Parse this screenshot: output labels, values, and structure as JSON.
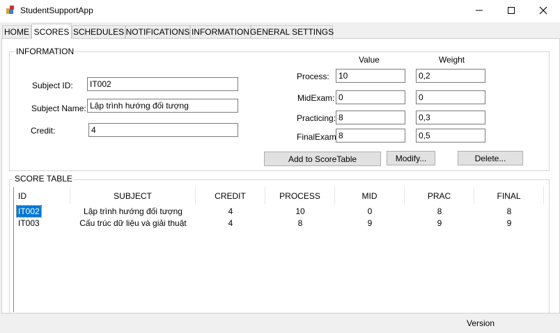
{
  "window": {
    "title": "StudentSupportApp",
    "icons": {
      "app": "app-icon",
      "minimize": "minimize-icon",
      "maximize": "maximize-icon",
      "close": "close-icon"
    }
  },
  "tabs": [
    "HOME",
    "SCORES",
    "SCHEDULES",
    "NOTIFICATIONS",
    "INFORMATION",
    "GENERAL SETTINGS"
  ],
  "active_tab": "SCORES",
  "information": {
    "group_label": "INFORMATION",
    "subject_id_label": "Subject ID:",
    "subject_id_value": "IT002",
    "subject_name_label": "Subject Name:",
    "subject_name_value": "Lập trình hướng đối tượng",
    "credit_label": "Credit:",
    "credit_value": "4",
    "value_header": "Value",
    "weight_header": "Weight",
    "process_label": "Process:",
    "process_value": "10",
    "process_weight": "0,2",
    "midexam_label": "MidExam:",
    "midexam_value": "0",
    "midexam_weight": "0",
    "practicing_label": "Practicing:",
    "practicing_value": "8",
    "practicing_weight": "0,3",
    "finalexam_label": "FinalExam:",
    "finalexam_value": "8",
    "finalexam_weight": "0,5",
    "add_button": "Add to ScoreTable",
    "modify_button": "Modify...",
    "delete_button": "Delete..."
  },
  "score_table": {
    "group_label": "SCORE TABLE",
    "columns": [
      "ID",
      "SUBJECT",
      "CREDIT",
      "PROCESS",
      "MID",
      "PRAC",
      "FINAL"
    ],
    "rows": [
      {
        "id": "IT002",
        "subject": "Lập trình hướng đối tượng",
        "credit": "4",
        "process": "10",
        "mid": "0",
        "prac": "8",
        "final": "8"
      },
      {
        "id": "IT003",
        "subject": "Cấu trúc dữ liệu và giải thuật",
        "credit": "4",
        "process": "8",
        "mid": "9",
        "prac": "9",
        "final": "9"
      }
    ],
    "selected_row": 0
  },
  "status": {
    "version_label": "Version"
  },
  "colors": {
    "selection": "#0078d7",
    "window_bg": "#f0f0f0",
    "page_bg": "#ffffff"
  }
}
